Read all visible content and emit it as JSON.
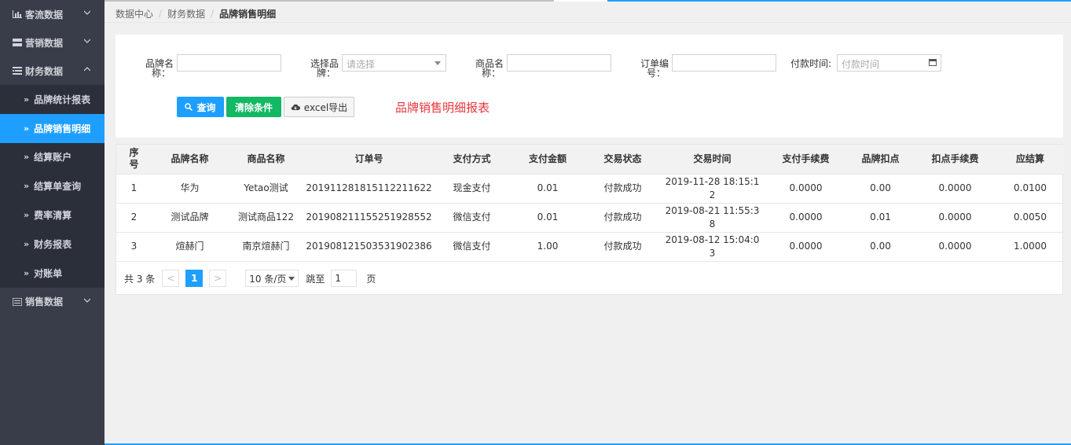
{
  "sidebar": {
    "groups": [
      {
        "label": "客流数据",
        "icon": "bar-chart-icon",
        "expanded": false
      },
      {
        "label": "营销数据",
        "icon": "server-icon",
        "expanded": false
      },
      {
        "label": "财务数据",
        "icon": "list-icon",
        "expanded": true
      },
      {
        "label": "销售数据",
        "icon": "server-icon",
        "expanded": false
      }
    ],
    "finance_items": [
      "品牌统计报表",
      "品牌销售明细",
      "结算账户",
      "结算单查询",
      "费率清算",
      "财务报表",
      "对账单"
    ],
    "active_item": "品牌销售明细",
    "sub_arrow": "»"
  },
  "breadcrumb": {
    "items": [
      "数据中心",
      "财务数据",
      "品牌销售明细"
    ],
    "sep": "/"
  },
  "filters": {
    "brand_name_label": "品牌名称：",
    "brand_name_label_l1": "品牌名",
    "brand_name_label_l2": "称：",
    "brand_name_value": "",
    "select_brand_label_l1": "选择品",
    "select_brand_label_l2": "牌：",
    "select_brand_placeholder": "请选择",
    "product_name_label_l1": "商品名",
    "product_name_label_l2": "称：",
    "product_name_value": "",
    "order_no_label_l1": "订单编",
    "order_no_label_l2": "号：",
    "order_no_value": "",
    "pay_time_label": "付款时间:",
    "pay_time_placeholder": "付款时间"
  },
  "buttons": {
    "query": "查询",
    "clear": "清除条件",
    "export": "excel导出"
  },
  "report_title": "品牌销售明细报表",
  "table": {
    "headers": [
      "序号",
      "品牌名称",
      "商品名称",
      "订单号",
      "支付方式",
      "支付金额",
      "交易状态",
      "交易时间",
      "支付手续费",
      "品牌扣点",
      "扣点手续费",
      "应结算"
    ],
    "header_seq_l1": "序",
    "header_seq_l2": "号",
    "rows": [
      {
        "seq": "1",
        "brand": "华为",
        "product": "Yetao测试",
        "order": "201911281815112211622",
        "pay_method": "现金支付",
        "amount": "0.01",
        "status": "付款成功",
        "time_l1": "2019-11-28 18:15:1",
        "time_l2": "2",
        "fee": "0.0000",
        "deduct": "0.00",
        "deduct_fee": "0.0000",
        "settle": "0.0100"
      },
      {
        "seq": "2",
        "brand": "测试品牌",
        "product": "测试商品122",
        "order": "201908211155251928552",
        "pay_method": "微信支付",
        "amount": "0.01",
        "status": "付款成功",
        "time_l1": "2019-08-21 11:55:3",
        "time_l2": "8",
        "fee": "0.0000",
        "deduct": "0.01",
        "deduct_fee": "0.0000",
        "settle": "0.0050"
      },
      {
        "seq": "3",
        "brand": "煊赫门",
        "product": "南京煊赫门",
        "order": "201908121503531902386",
        "pay_method": "微信支付",
        "amount": "1.00",
        "status": "付款成功",
        "time_l1": "2019-08-12 15:04:0",
        "time_l2": "3",
        "fee": "0.0000",
        "deduct": "0.00",
        "deduct_fee": "0.0000",
        "settle": "1.0000"
      }
    ]
  },
  "pager": {
    "total": "共 3 条",
    "prev": "<",
    "current": "1",
    "next": ">",
    "page_size": "10 条/页",
    "jump_label": "跳至",
    "jump_value": "1",
    "page_unit": "页"
  },
  "colors": {
    "sidebar_bg": "#393d49",
    "sub_bg": "#2b2f3a",
    "accent": "#1e9fff",
    "green": "#13b863",
    "title_red": "#e8363b"
  }
}
